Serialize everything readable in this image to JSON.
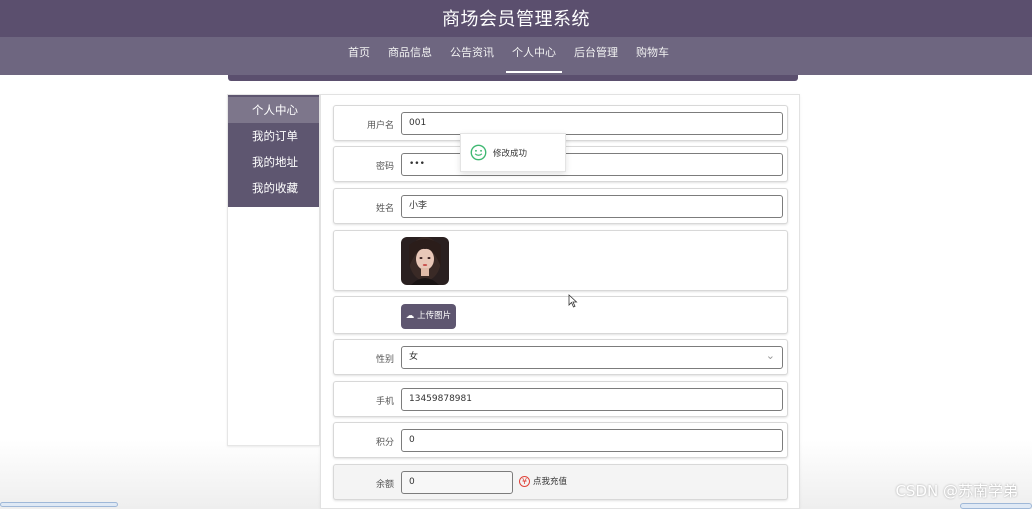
{
  "header": {
    "title": "商场会员管理系统"
  },
  "nav": {
    "items": [
      {
        "label": "首页"
      },
      {
        "label": "商品信息"
      },
      {
        "label": "公告资讯"
      },
      {
        "label": "个人中心"
      },
      {
        "label": "后台管理"
      },
      {
        "label": "购物车"
      }
    ],
    "active": "个人中心"
  },
  "sidebar": {
    "items": [
      {
        "label": "个人中心"
      },
      {
        "label": "我的订单"
      },
      {
        "label": "我的地址"
      },
      {
        "label": "我的收藏"
      }
    ]
  },
  "form": {
    "username": {
      "label": "用户名",
      "value": "001"
    },
    "password": {
      "label": "密码",
      "value": "•••"
    },
    "name": {
      "label": "姓名",
      "value": "小李"
    },
    "upload": {
      "label": "上传图片"
    },
    "gender": {
      "label": "性别",
      "value": "女"
    },
    "phone": {
      "label": "手机",
      "value": "13459878981"
    },
    "points": {
      "label": "积分",
      "value": "0"
    },
    "balance": {
      "label": "余额",
      "value": "0"
    },
    "recharge": {
      "label": "点我充值"
    }
  },
  "toast": {
    "message": "修改成功"
  },
  "watermark": {
    "text": "CSDN @苏南学弟"
  },
  "colors": {
    "header": "#5b4f6e",
    "nav": "#6e6680",
    "sidebar": "#5e5670",
    "toast_icon": "#3fb872"
  },
  "icons": {
    "toast": "smile-icon",
    "upload": "cloud-upload-icon",
    "recharge": "recharge-icon",
    "select": "chevron-down-icon"
  }
}
